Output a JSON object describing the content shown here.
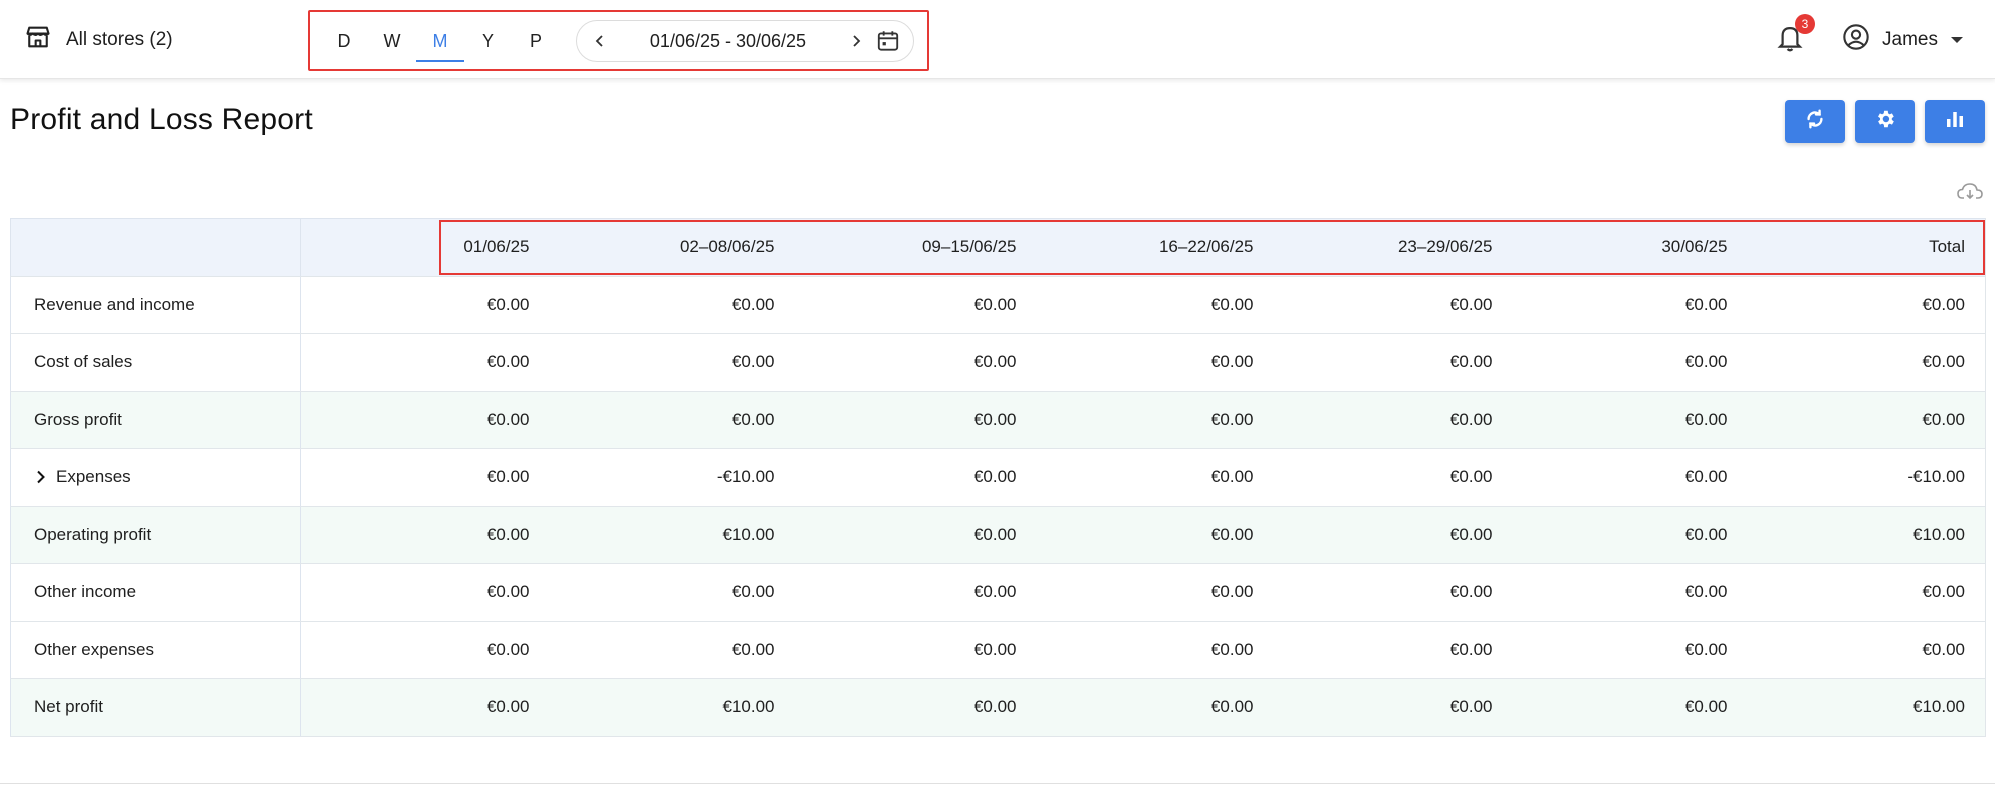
{
  "topbar": {
    "store_label": "All stores (2)",
    "period_tabs": [
      {
        "label": "D",
        "active": false
      },
      {
        "label": "W",
        "active": false
      },
      {
        "label": "M",
        "active": true
      },
      {
        "label": "Y",
        "active": false
      },
      {
        "label": "P",
        "active": false
      }
    ],
    "date_range": "01/06/25 - 30/06/25",
    "notification_count": "3",
    "user_name": "James"
  },
  "header": {
    "title": "Profit and Loss Report",
    "actions": [
      "refresh-icon",
      "settings-icon",
      "bar-chart-icon"
    ]
  },
  "colors": {
    "accent": "#3d7fe6",
    "highlight_box": "#e53935",
    "header_bg": "#eef3fb",
    "row_highlight_bg": "#f3faf7"
  },
  "table": {
    "columns": [
      "01/06/25",
      "02–08/06/25",
      "09–15/06/25",
      "16–22/06/25",
      "23–29/06/25",
      "30/06/25",
      "Total"
    ],
    "rows": [
      {
        "label": "Revenue and income",
        "highlight": false,
        "expandable": false,
        "values": [
          "€0.00",
          "€0.00",
          "€0.00",
          "€0.00",
          "€0.00",
          "€0.00",
          "€0.00"
        ]
      },
      {
        "label": "Cost of sales",
        "highlight": false,
        "expandable": false,
        "values": [
          "€0.00",
          "€0.00",
          "€0.00",
          "€0.00",
          "€0.00",
          "€0.00",
          "€0.00"
        ]
      },
      {
        "label": "Gross profit",
        "highlight": true,
        "expandable": false,
        "values": [
          "€0.00",
          "€0.00",
          "€0.00",
          "€0.00",
          "€0.00",
          "€0.00",
          "€0.00"
        ]
      },
      {
        "label": "Expenses",
        "highlight": false,
        "expandable": true,
        "values": [
          "€0.00",
          "-€10.00",
          "€0.00",
          "€0.00",
          "€0.00",
          "€0.00",
          "-€10.00"
        ]
      },
      {
        "label": "Operating profit",
        "highlight": true,
        "expandable": false,
        "values": [
          "€0.00",
          "€10.00",
          "€0.00",
          "€0.00",
          "€0.00",
          "€0.00",
          "€10.00"
        ]
      },
      {
        "label": "Other income",
        "highlight": false,
        "expandable": false,
        "values": [
          "€0.00",
          "€0.00",
          "€0.00",
          "€0.00",
          "€0.00",
          "€0.00",
          "€0.00"
        ]
      },
      {
        "label": "Other expenses",
        "highlight": false,
        "expandable": false,
        "values": [
          "€0.00",
          "€0.00",
          "€0.00",
          "€0.00",
          "€0.00",
          "€0.00",
          "€0.00"
        ]
      },
      {
        "label": "Net profit",
        "highlight": true,
        "expandable": false,
        "values": [
          "€0.00",
          "€10.00",
          "€0.00",
          "€0.00",
          "€0.00",
          "€0.00",
          "€10.00"
        ]
      }
    ]
  }
}
